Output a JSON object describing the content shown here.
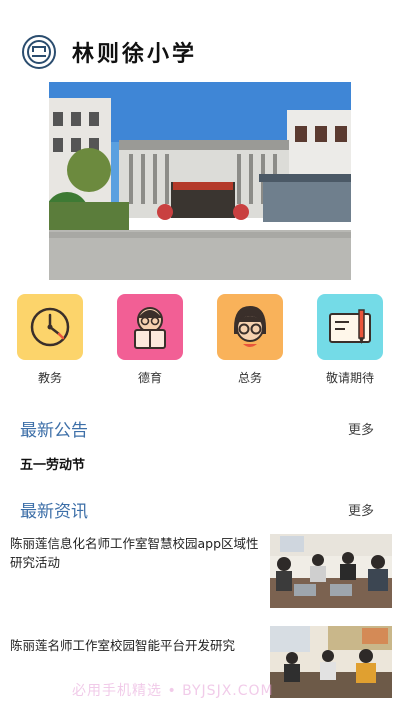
{
  "header": {
    "school_name": "林则徐小学"
  },
  "menu": [
    {
      "label": "教务",
      "icon": "clock-icon",
      "color": "#fcd46b"
    },
    {
      "label": "德育",
      "icon": "reading-child-icon",
      "color": "#f25f95"
    },
    {
      "label": "总务",
      "icon": "glasses-girl-icon",
      "color": "#f9b25a"
    },
    {
      "label": "敬请期待",
      "icon": "notepad-pen-icon",
      "color": "#74dbe7"
    }
  ],
  "announcements": {
    "title": "最新公告",
    "more": "更多",
    "items": [
      "五一劳动节"
    ]
  },
  "news": {
    "title": "最新资讯",
    "more": "更多",
    "items": [
      {
        "title": "陈丽莲信息化名师工作室智慧校园app区域性研究活动"
      },
      {
        "title": "陈丽莲名师工作室校园智能平台开发研究"
      }
    ]
  },
  "watermark": "必用手机精选 • BYJSJX.COM"
}
